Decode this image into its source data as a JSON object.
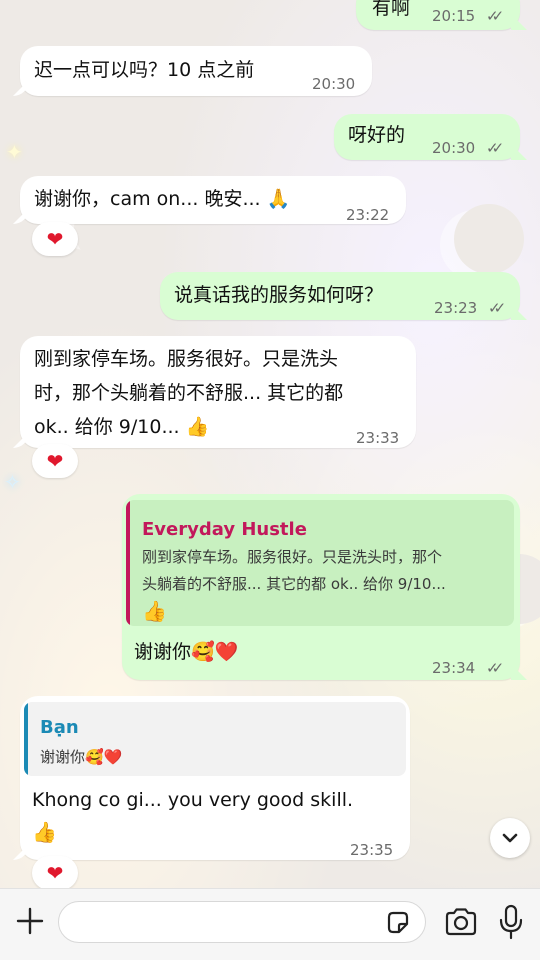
{
  "chat": {
    "messages": [
      {
        "id": "m0",
        "direction": "out",
        "text": "有啊",
        "time": "20:15",
        "status": "read"
      },
      {
        "id": "m1",
        "direction": "in",
        "text": "迟一点可以吗？10 点之前",
        "time": "20:30"
      },
      {
        "id": "m2",
        "direction": "out",
        "text": "呀好的",
        "time": "20:30",
        "status": "read"
      },
      {
        "id": "m3",
        "direction": "in",
        "text": "谢谢你，cam on... 晚安... 🙏",
        "time": "23:22",
        "reaction": "❤"
      },
      {
        "id": "m4",
        "direction": "out",
        "text": "说真话我的服务如何呀？",
        "time": "23:23",
        "status": "read"
      },
      {
        "id": "m5",
        "direction": "in",
        "lines": [
          "刚到家停车场。服务很好。只是洗头",
          "时，那个头躺着的不舒服... 其它的都",
          "ok.. 给你 9/10... 👍"
        ],
        "time": "23:33",
        "reaction": "❤"
      },
      {
        "id": "m6",
        "direction": "out",
        "quote": {
          "author": "Everyday Hustle",
          "lines": [
            "刚到家停车场。服务很好。只是洗头时，那个",
            "头躺着的不舒服... 其它的都 ok.. 给你 9/10..."
          ],
          "emoji": "👍",
          "author_color": "#c2185b"
        },
        "text": "谢谢你🥰❤️",
        "time": "23:34",
        "status": "read"
      },
      {
        "id": "m7",
        "direction": "in",
        "quote": {
          "author": "Bạn",
          "text": "谢谢你🥰❤️",
          "author_color": "#1b8ab5"
        },
        "text": "Khong co gi... you very good skill.",
        "emoji": "👍",
        "time": "23:35",
        "reaction": "❤"
      }
    ]
  },
  "composer": {
    "placeholder": "",
    "value": ""
  },
  "icons": {
    "plus": "plus-icon",
    "sticker": "sticker-icon",
    "camera": "camera-icon",
    "mic": "microphone-icon",
    "scroll": "chevron-down-icon",
    "read_ticks": "double-check-icon"
  },
  "colors": {
    "incoming_bubble": "#ffffff",
    "outgoing_bubble": "#d9fdd3",
    "reaction_heart": "#e0182d"
  }
}
